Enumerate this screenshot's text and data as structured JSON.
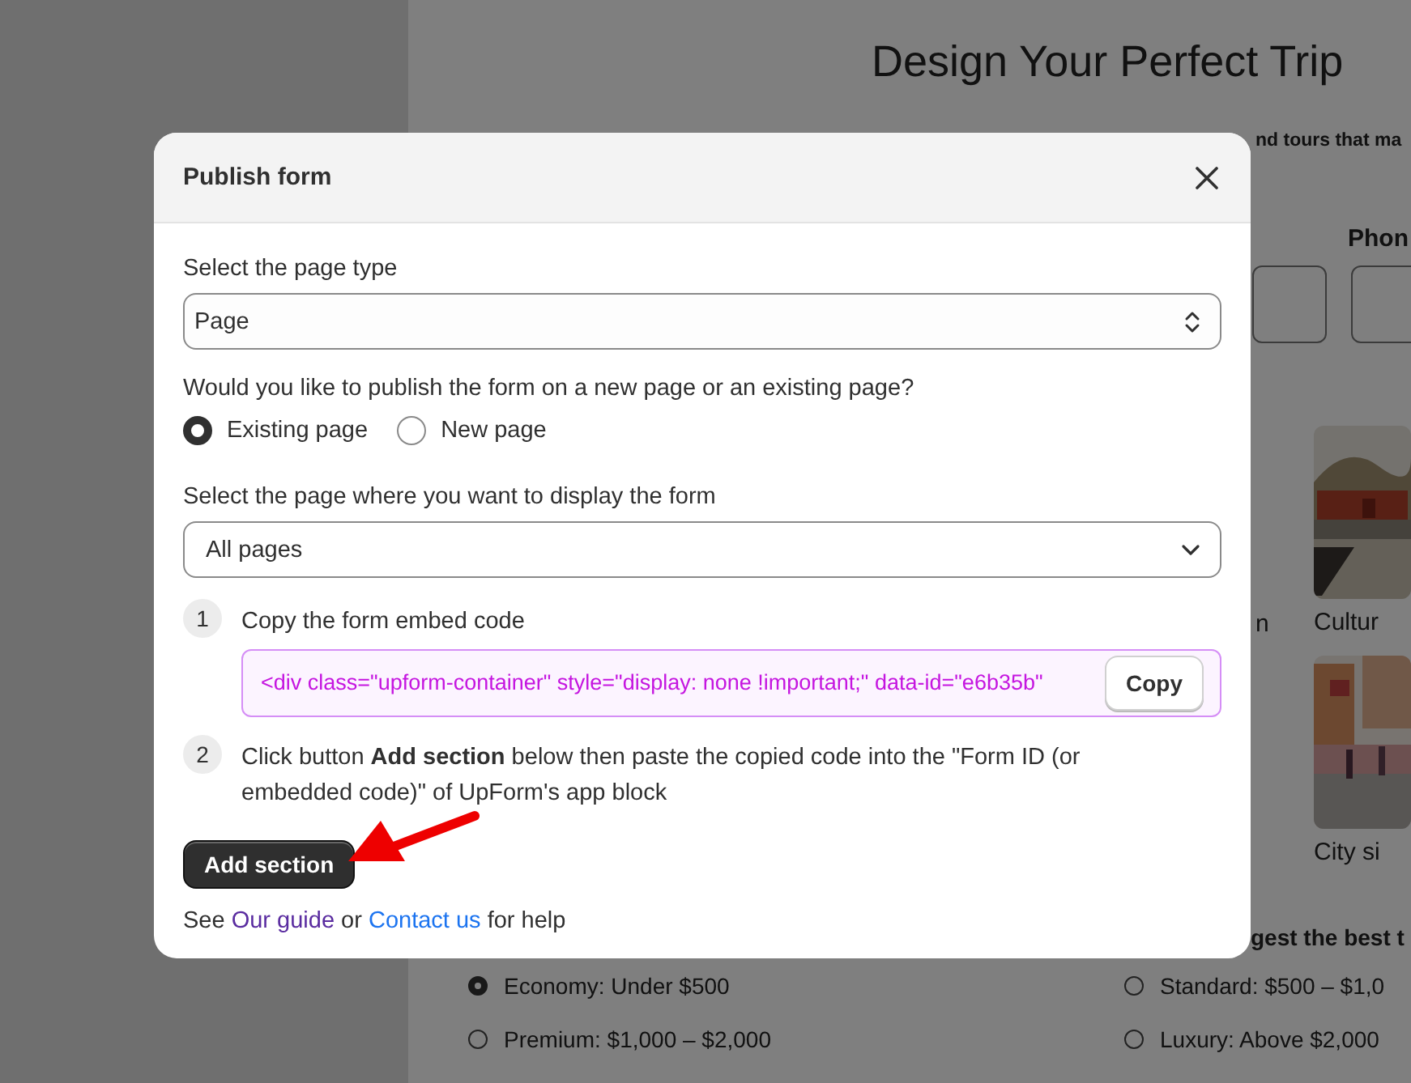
{
  "page": {
    "title": "Design Your Perfect Trip",
    "subtitle_fragment": "nd tours that ma",
    "field_label": "Phon",
    "side_caption": "n",
    "tiles": [
      {
        "kind": "picture",
        "caption": "Cultur"
      },
      {
        "kind": "picture",
        "caption": "City si"
      }
    ],
    "question_fragment": "gest the best t",
    "budget_options": [
      {
        "label": "Economy: Under $500",
        "selected": true
      },
      {
        "label": "Standard: $500 – $1,0",
        "selected": false
      },
      {
        "label": "Premium: $1,000 – $2,000",
        "selected": false
      },
      {
        "label": "Luxury: Above $2,000",
        "selected": false
      }
    ]
  },
  "dialog": {
    "title": "Publish form",
    "page_type": {
      "label": "Select the page type",
      "value": "Page"
    },
    "publish_question": "Would you like to publish the form on a new page or an existing page?",
    "publish_options": [
      {
        "label": "Existing page",
        "selected": true
      },
      {
        "label": "New page",
        "selected": false
      }
    ],
    "display": {
      "label": "Select the page where you want to display the form",
      "value": "All pages"
    },
    "steps": [
      {
        "kind": "code",
        "number": "1",
        "text": "Copy the form embed code",
        "code": "<div class=\"upform-container\" style=\"display: none !important;\" data-id=\"e6b35b\"",
        "button": "Copy"
      },
      {
        "kind": "text",
        "number": "2",
        "text": "Click button **Add section** below then paste the copied code into the \"Form ID (or embedded code)\" of UpForm's app block"
      }
    ],
    "primary_button": "Add section",
    "help": {
      "prefix": "See",
      "guide_link": "Our guide",
      "middle": "or",
      "contact_link": "Contact us",
      "suffix": "for help"
    }
  }
}
